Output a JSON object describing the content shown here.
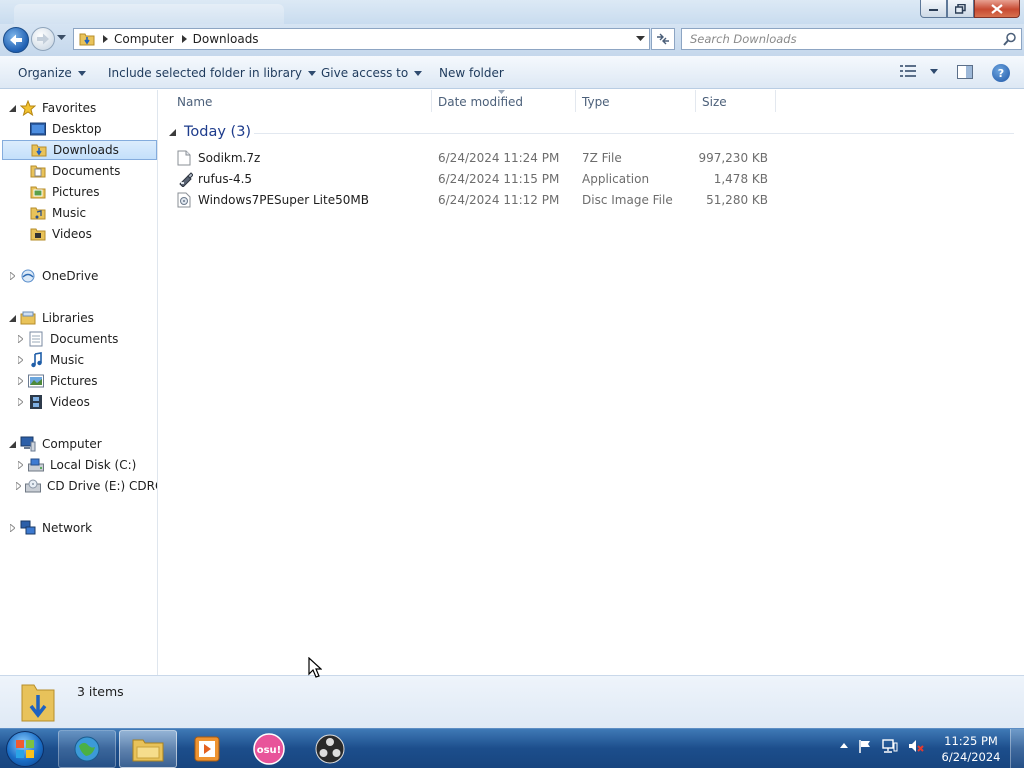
{
  "window": {
    "controls": {
      "minimize_icon": "minimize-icon",
      "maximize_icon": "maximize-icon",
      "close_icon": "close-icon"
    }
  },
  "address": {
    "crumbs": [
      "Computer",
      "Downloads"
    ],
    "search_placeholder": "Search Downloads"
  },
  "toolbar": {
    "organize": "Organize",
    "include": "Include selected folder in library",
    "share": "Give access to",
    "new_folder": "New folder"
  },
  "nav": {
    "favorites": "Favorites",
    "fav_items": [
      "Desktop",
      "Downloads",
      "Documents",
      "Pictures",
      "Music",
      "Videos"
    ],
    "onedrive": "OneDrive",
    "libraries": "Libraries",
    "lib_items": [
      "Documents",
      "Music",
      "Pictures",
      "Videos"
    ],
    "computer": "Computer",
    "drives": [
      "Local Disk (C:)",
      "CD Drive (E:) CDROM"
    ],
    "network": "Network",
    "selected": "Downloads"
  },
  "columns": {
    "name": "Name",
    "date": "Date modified",
    "type": "Type",
    "size": "Size"
  },
  "group": {
    "title": "Today (3)"
  },
  "files": [
    {
      "name": "Sodikm.7z",
      "date": "6/24/2024 11:24 PM",
      "type": "7Z File",
      "size": "997,230 KB",
      "icon": "file-icon"
    },
    {
      "name": "rufus-4.5",
      "date": "6/24/2024 11:15 PM",
      "type": "Application",
      "size": "1,478 KB",
      "icon": "usb-drive-icon"
    },
    {
      "name": "Windows7PESuper Lite50MB",
      "date": "6/24/2024 11:12 PM",
      "type": "Disc Image File",
      "size": "51,280 KB",
      "icon": "disc-image-icon"
    }
  ],
  "status": {
    "count": "3 items"
  },
  "taskbar": {
    "apps": [
      "start-orb",
      "browser-icon",
      "explorer-icon",
      "media-player-icon",
      "osu-icon",
      "obs-icon"
    ],
    "osu_label": "osu!",
    "time": "11:25 PM",
    "date": "6/24/2024"
  },
  "colors": {
    "accent": "#1e3c8c",
    "selection": "#c4e0fb",
    "taskbar": "#1c4e8c"
  }
}
